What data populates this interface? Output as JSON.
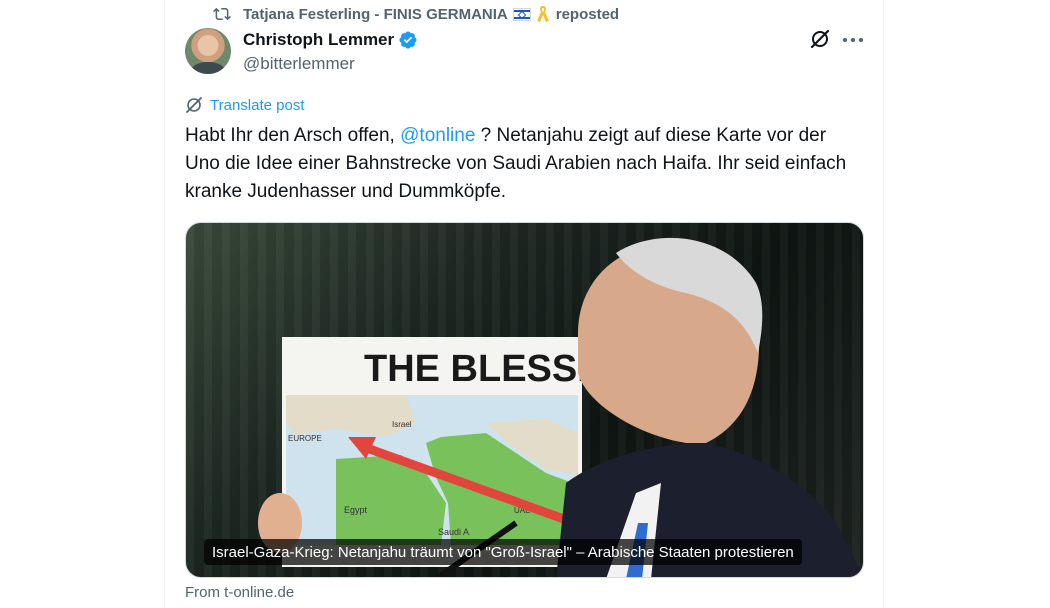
{
  "repost": {
    "reposter": "Tatjana Festerling - FINIS GERMANIA",
    "label": "reposted"
  },
  "author": {
    "name": "Christoph Lemmer",
    "handle": "@bitterlemmer"
  },
  "translate_label": "Translate post",
  "post": {
    "text_before": "Habt Ihr den Arsch offen, ",
    "mention": "@tonline",
    "text_after": " ? Netanjahu zeigt auf diese Karte vor der Uno die Idee einer Bahnstrecke von Saudi Arabien nach Haifa. Ihr seid einfach kranke Judenhasser und Dummköpfe."
  },
  "media": {
    "sign_title": "THE BLESSING",
    "map_labels": {
      "europe": "EUROPE",
      "israel": "Israel",
      "egypt": "Egypt",
      "saudi": "Saudi A",
      "uae": "UAE"
    },
    "caption": "Israel-Gaza-Krieg: Netanjahu träumt von \"Groß-Israel\" – Arabische Staaten protestieren"
  },
  "source": "From t-online.de",
  "colors": {
    "accent": "#1d9bf0",
    "muted": "#536471",
    "text": "#0f1419",
    "arrow": "#e2453c",
    "map_green": "#79c25b"
  },
  "icons": {
    "repost": "repost-icon",
    "verified": "verified-badge-icon",
    "grok": "grok-icon",
    "more": "more-icon",
    "translate": "translate-icon"
  }
}
